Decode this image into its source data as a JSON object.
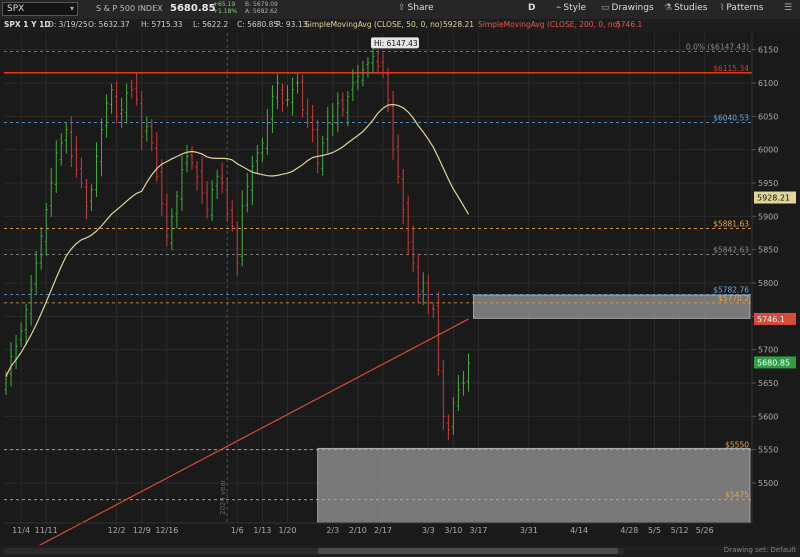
{
  "toolbar": {
    "symbol": "SPX",
    "name": "S & P 500 INDEX",
    "last": "5680.85",
    "change": "+65.19",
    "change_pct": "+1.18%",
    "bid": "B: 5679.09",
    "ask": "A: 5682.62",
    "share_label": "Share",
    "d_label": "D",
    "style_label": "Style",
    "drawings_label": "Drawings",
    "studies_label": "Studies",
    "patterns_label": "Patterns"
  },
  "info": {
    "title": "SPX 1 Y 1D",
    "date": "D: 3/19/25",
    "open": "O: 5632.37",
    "high": "H: 5715.33",
    "low": "L: 5622.2",
    "close": "C: 5680.85",
    "range": "R: 93.13",
    "sma50_label": "SimpleMovingAvg (CLOSE, 50, 0, no)",
    "sma50_value": "5928.21",
    "sma200_label": "SimpleMovingAvg (CLOSE, 200, 0, no)",
    "sma200_value": "5746.1"
  },
  "colors": {
    "up": "#3fae3f",
    "down": "#d03a3a",
    "sma50": "#e0d59a",
    "sma200": "#d84a3a",
    "resistance": "#d43a1e",
    "fib_orange": "#e8a640",
    "fib_blue": "#6fa8d8",
    "fib_gray": "#8a8a8a",
    "last_price": "#2ea043"
  },
  "chart_data": {
    "type": "candlestick",
    "ylim": [
      5440,
      6175
    ],
    "price_ticks": [
      5500,
      5550,
      5600,
      5650,
      5700,
      5750,
      5800,
      5850,
      5900,
      5950,
      6000,
      6050,
      6100,
      6150
    ],
    "x_ticks": [
      {
        "label": "11/4",
        "i": 3
      },
      {
        "label": "11/11",
        "i": 8
      },
      {
        "label": "12/2",
        "i": 22
      },
      {
        "label": "12/9",
        "i": 27
      },
      {
        "label": "12/16",
        "i": 32
      },
      {
        "label": "1/6",
        "i": 46
      },
      {
        "label": "1/13",
        "i": 51
      },
      {
        "label": "1/20",
        "i": 56
      },
      {
        "label": "2/3",
        "i": 65
      },
      {
        "label": "2/10",
        "i": 70
      },
      {
        "label": "2/17",
        "i": 75
      },
      {
        "label": "3/3",
        "i": 84
      },
      {
        "label": "3/10",
        "i": 89
      },
      {
        "label": "3/17",
        "i": 94
      },
      {
        "label": "3/31",
        "i": 104
      },
      {
        "label": "4/14",
        "i": 114
      },
      {
        "label": "4/28",
        "i": 124
      },
      {
        "label": "5/5",
        "i": 129
      },
      {
        "label": "5/12",
        "i": 134
      },
      {
        "label": "5/26",
        "i": 139
      }
    ],
    "year_label": "2024 year",
    "year_index": 44,
    "hi_label": "Hi: 6147.43",
    "closes": [
      5660,
      5690,
      5705,
      5728,
      5760,
      5790,
      5830,
      5870,
      5910,
      5950,
      5995,
      6010,
      6030,
      5990,
      5970,
      5950,
      5915,
      5940,
      5990,
      6030,
      6070,
      6090,
      6050,
      6060,
      6085,
      6090,
      6075,
      6020,
      6035,
      6010,
      5960,
      5920,
      5870,
      5900,
      5930,
      5970,
      5990,
      5980,
      5960,
      5935,
      5910,
      5940,
      5960,
      5950,
      5905,
      5885,
      5830,
      5915,
      5945,
      5975,
      5995,
      6010,
      6040,
      6080,
      6100,
      6070,
      6075,
      6090,
      6100,
      6060,
      6040,
      6030,
      5980,
      6010,
      6040,
      6050,
      6070,
      6060,
      6080,
      6100,
      6110,
      6120,
      6130,
      6140,
      6125,
      6115,
      6075,
      6000,
      5960,
      5910,
      5860,
      5830,
      5780,
      5800,
      5770,
      5760,
      5670,
      5600,
      5580,
      5620,
      5640,
      5650,
      5680
    ],
    "levels": [
      {
        "label": "0.0% ($6147.43)",
        "price": 6147.43,
        "kind": "gray"
      },
      {
        "label": "$6115.34",
        "price": 6115.34,
        "kind": "resistance"
      },
      {
        "label": "$6040.53",
        "price": 6040.53,
        "kind": "blue"
      },
      {
        "label": "$5881.63",
        "price": 5881.63,
        "kind": "orange"
      },
      {
        "label": "$5842.63",
        "price": 5842.63,
        "kind": "gray"
      },
      {
        "label": "$5782.76",
        "price": 5782.76,
        "kind": "blue"
      },
      {
        "label": "$5770.2",
        "price": 5770.2,
        "kind": "orange"
      },
      {
        "label": "$5550",
        "price": 5550,
        "kind": "orange"
      },
      {
        "label": "$5475",
        "price": 5475,
        "kind": "orange"
      }
    ],
    "zones": [
      {
        "top": 5782,
        "bottom": 5747,
        "i_start": 93,
        "i_end": 148
      },
      {
        "top": 5552,
        "bottom": 5440,
        "i_start": 62,
        "i_end": 148
      }
    ],
    "price_tags": [
      {
        "value": "5928.21",
        "price": 5928.21,
        "color": "#e0d59a",
        "text": "#111"
      },
      {
        "value": "5746.1",
        "price": 5746.1,
        "color": "#d84a3a",
        "text": "#fff"
      },
      {
        "value": "5680.85",
        "price": 5680.85,
        "color": "#2ea043",
        "text": "#fff"
      }
    ]
  },
  "bottom": {
    "drawing_set": "Drawing set: Default"
  }
}
